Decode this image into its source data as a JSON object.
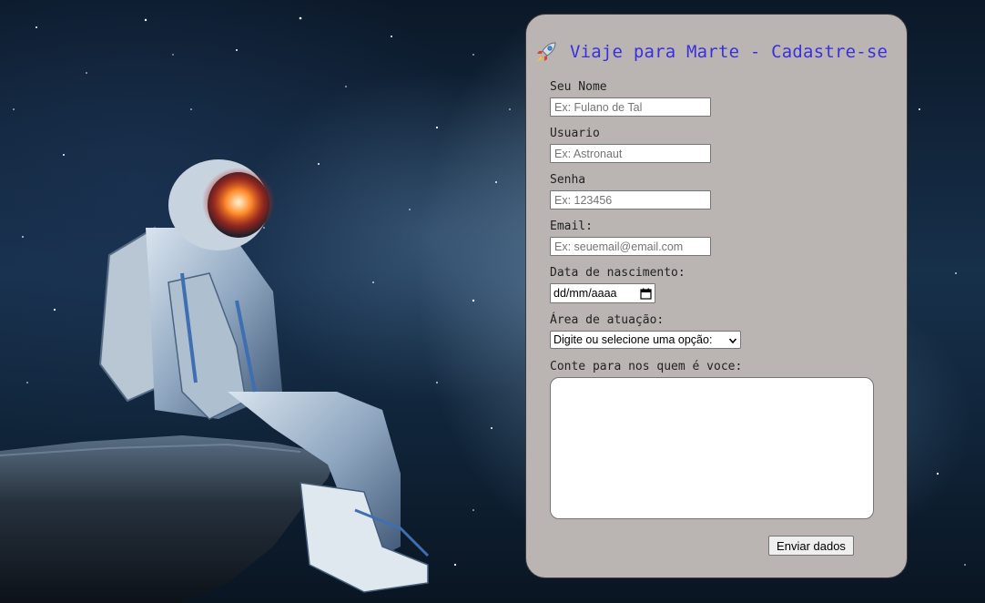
{
  "form": {
    "title": "Viaje para Marte - Cadastre-se",
    "title_icon": "rocket-icon",
    "title_color": "#3a2fe0",
    "card_color": "#bab5b3",
    "fields": {
      "name": {
        "label": "Seu Nome",
        "placeholder": "Ex: Fulano de Tal",
        "value": ""
      },
      "user": {
        "label": "Usuario",
        "placeholder": "Ex: Astronaut",
        "value": ""
      },
      "password": {
        "label": "Senha",
        "placeholder": "Ex: 123456",
        "value": ""
      },
      "email": {
        "label": "Email:",
        "placeholder": "Ex: seuemail@email.com",
        "value": ""
      },
      "birthdate": {
        "label": "Data de nascimento:",
        "value": "dd/mm/aaaa",
        "icon": "calendar-icon"
      },
      "area": {
        "label": "Área de atuação:",
        "selected": "Digite ou selecione uma opção:",
        "icon": "chevron-down-icon"
      },
      "about": {
        "label": "Conte para nos quem é voce:",
        "value": ""
      }
    },
    "submit_label": "Enviar dados"
  },
  "background": {
    "description_icon": "astronaut-illustration"
  }
}
